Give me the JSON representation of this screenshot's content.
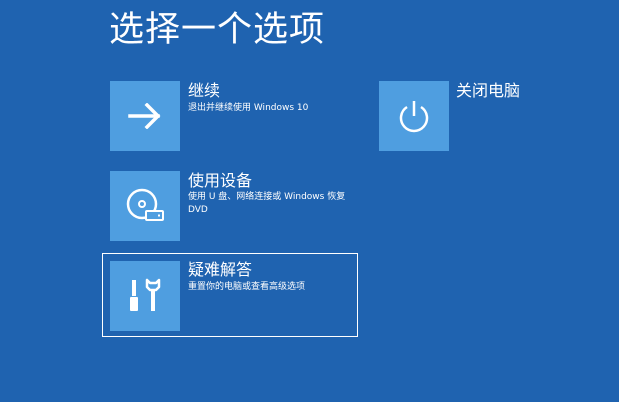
{
  "page": {
    "title": "选择一个选项",
    "background_color": "#1f63b0",
    "tile_color": "#4f9ee0"
  },
  "options": {
    "continue": {
      "icon": "arrow-right-icon",
      "title": "继续",
      "description": "退出并继续使用 Windows 10"
    },
    "use_device": {
      "icon": "disc-drive-icon",
      "title": "使用设备",
      "description": "使用 U 盘、网络连接或 Windows 恢复 DVD"
    },
    "troubleshoot": {
      "icon": "tools-icon",
      "title": "疑难解答",
      "description": "重置你的电脑或查看高级选项",
      "selected": true
    },
    "power_off": {
      "icon": "power-icon",
      "title": "关闭电脑"
    }
  }
}
